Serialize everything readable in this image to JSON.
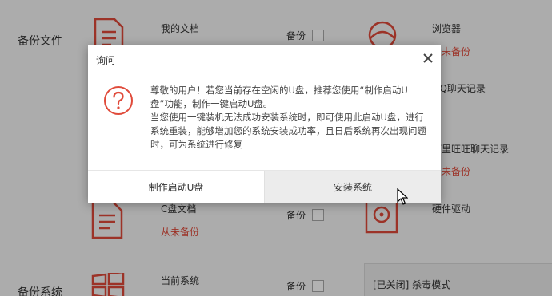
{
  "background": {
    "sections": {
      "backup_files": "备份文件",
      "backup_system": "备份系统"
    },
    "items": {
      "my_docs": {
        "name": "我的文档"
      },
      "browser": {
        "name": "浏览器",
        "status": "从未备份"
      },
      "qq_chat": {
        "name": "QQ聊天记录"
      },
      "wangwang": {
        "name": "阿里旺旺聊天记录",
        "status": "从未备份"
      },
      "c_docs": {
        "name": "C盘文档",
        "status": "从未备份"
      },
      "drivers": {
        "name": "硬件驱动"
      },
      "current_system": {
        "name": "当前系统"
      }
    },
    "backup_label": "备份",
    "antivirus_notice": "[已关闭]  杀毒模式"
  },
  "dialog": {
    "title": "询问",
    "message_1": "尊敬的用户！若您当前存在空闲的U盘，推荐您使用“制作启动U盘”功能，制作一键启动U盘。",
    "message_2": "当您使用一键装机无法成功安装系统时，即可使用此启动U盘，进行系统重装，能够增加您的系统安装成功率，且日后系统再次出现问题时，可为系统进行修复",
    "make_usb_label": "制作启动U盘",
    "install_label": "安装系统"
  },
  "colors": {
    "accent": "#e04a3a",
    "overlay": "rgba(0,0,0,0.30)"
  }
}
